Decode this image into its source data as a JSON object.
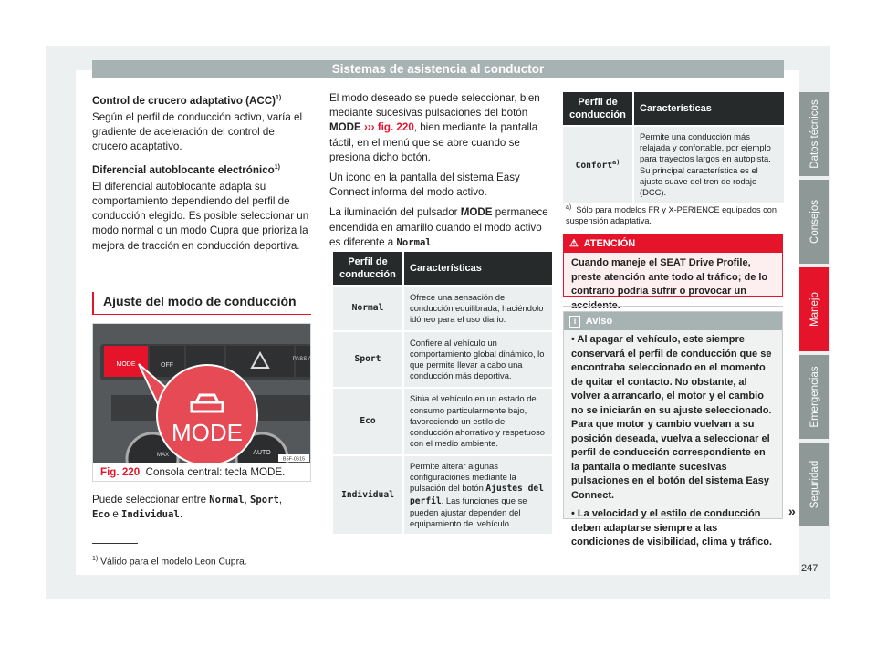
{
  "header": {
    "title": "Sistemas de asistencia al conductor"
  },
  "left": {
    "acc_title": "Control de crucero adaptativo (ACC)",
    "acc_sup": "1)",
    "acc_text": "Según el perfil de conducción activo, varía el gradiente de aceleración del control de crucero adaptativo.",
    "diff_title": "Diferencial autoblocante electrónico",
    "diff_sup": "1)",
    "diff_text": "El diferencial autoblocante adapta su comportamiento dependiendo del perfil de conducción elegido. Es posible seleccionar un modo normal o un modo Cupra que prioriza la mejora de tracción en conducción deportiva.",
    "section_title": "Ajuste del modo de conducción",
    "figure": {
      "buttons": [
        "MODE",
        "OFF",
        "PASS AI",
        "AUTO",
        "MAX"
      ],
      "callout": "MODE",
      "code": "B5F-0615",
      "fig_label": "Fig. 220",
      "caption": "Consola central: tecla MODE."
    },
    "select_pre": "Puede seleccionar entre ",
    "modes": [
      "Normal",
      "Sport",
      "Eco",
      "Individual"
    ],
    "sep1": ", ",
    "sep2": " e ",
    "end": "."
  },
  "middle": {
    "p1_a": "El modo deseado se puede seleccionar, bien mediante sucesivas pulsaciones del botón ",
    "p1_mode": "MODE",
    "p1_ref": "››› fig. 220",
    "p1_b": ", bien mediante la pantalla táctil, en el menú que se abre cuando se presiona dicho botón.",
    "p2": "Un icono en la pantalla del sistema Easy Connect informa del modo activo.",
    "p3_a": "La iluminación del pulsador ",
    "p3_mode": "MODE",
    "p3_b": " permanece encendida en amarillo cuando el modo activo es diferente a ",
    "p3_normal": "Normal",
    "p3_end": ".",
    "table": {
      "headers": [
        "Perfil de conducción",
        "Características"
      ],
      "rows": [
        {
          "profile": "Normal",
          "desc": "Ofrece una sensación de conducción equilibrada, haciéndolo idóneo para el uso diario."
        },
        {
          "profile": "Sport",
          "desc": "Confiere al vehículo un comportamiento global dinámico, lo que permite llevar a cabo una conducción más deportiva."
        },
        {
          "profile": "Eco",
          "desc": "Sitúa el vehículo en un estado de consumo particularmente bajo, favoreciendo un estilo de conducción ahorrativo y respetuoso con el medio ambiente."
        },
        {
          "profile": "Individual",
          "desc_a": "Permite alterar algunas configuraciones mediante la pulsación del botón ",
          "desc_btn": "Ajustes del perfil",
          "desc_b": ". Las funciones que se pueden ajustar dependen del equipamiento del vehículo."
        }
      ]
    }
  },
  "right": {
    "table": {
      "headers": [
        "Perfil de conducción",
        "Características"
      ],
      "rows": [
        {
          "profile": "Confort",
          "sup": "a)",
          "desc": "Permite una conducción más relajada y confortable, por ejemplo para trayectos largos en autopista. Su principal característica es el ajuste suave del tren de rodaje (DCC)."
        }
      ]
    },
    "footnote_mark": "a)",
    "footnote": "Sólo para modelos FR y X-PERIENCE equipados con suspensión adaptativa.",
    "warning": {
      "icon": "warning-triangle-icon",
      "title": "ATENCIÓN",
      "text": "Cuando maneje el SEAT Drive Profile, preste atención ante todo al tráfico; de lo contrario podría sufrir o provocar un accidente."
    },
    "notice": {
      "icon": "info-icon",
      "title": "Aviso",
      "items": [
        "Al apagar el vehículo, este siempre conservará el perfil de conducción que se encontraba seleccionado en el momento de quitar el contacto. No obstante, al volver a arrancarlo, el motor y el cambio no se iniciarán en su ajuste seleccionado. Para que motor y cambio vuelvan a su posición deseada, vuelva a seleccionar el perfil de conducción correspondiente en la pantalla o mediante sucesivas pulsaciones en el botón del sistema Easy Connect.",
        "La velocidad y el estilo de conducción deben adaptarse siempre a las condiciones de visibilidad, clima y tráfico."
      ]
    },
    "continue_mark": "»"
  },
  "side_tabs": [
    {
      "label": "Datos técnicos",
      "active": false
    },
    {
      "label": "Consejos",
      "active": false
    },
    {
      "label": "Manejo",
      "active": true
    },
    {
      "label": "Emergencias",
      "active": false
    },
    {
      "label": "Seguridad",
      "active": false
    }
  ],
  "footer": {
    "footnote_mark": "1)",
    "footnote": "Válido para el modelo Leon Cupra.",
    "page_number": "247"
  },
  "colors": {
    "accent": "#e5142b",
    "header_bg": "#a7b3b2",
    "table_head": "#262a2b",
    "tab_bg": "#8e9896"
  }
}
